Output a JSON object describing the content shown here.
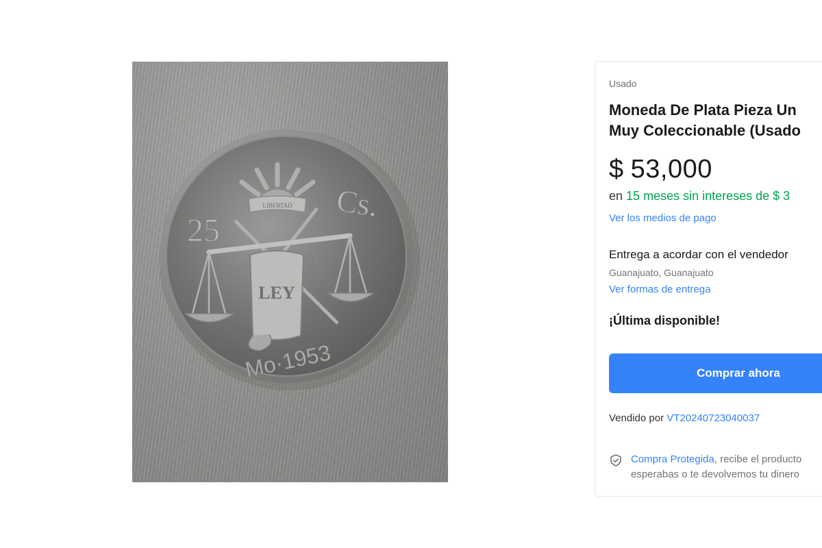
{
  "product_image": {
    "alt": "Moneda de plata 25 Cs. Mo 1953"
  },
  "buy_box": {
    "condition": "Usado",
    "title_line1": "Moneda De Plata Pieza Un",
    "title_line2": "Muy Coleccionable (Usado",
    "price": {
      "currency": "$",
      "amount": "53,000"
    },
    "installments": {
      "prefix": "en",
      "highlight": "15 meses sin intereses de $ 3"
    },
    "payment_link": "Ver los medios de pago",
    "delivery": {
      "title": "Entrega a acordar con el vendedor",
      "location": "Guanajuato, Guanajuato",
      "link": "Ver formas de entrega"
    },
    "stock_label": "¡Última disponible!",
    "buy_button": "Comprar ahora",
    "seller": {
      "prefix": "Vendido por",
      "name": "VT20240723040037"
    },
    "protection": {
      "link": "Compra Protegida",
      "text_line1": ", recibe el producto",
      "text_line2": "esperabas o te devolvemos tu dinero"
    }
  },
  "colors": {
    "accent": "#3483fa",
    "installments_green": "#00a650"
  }
}
